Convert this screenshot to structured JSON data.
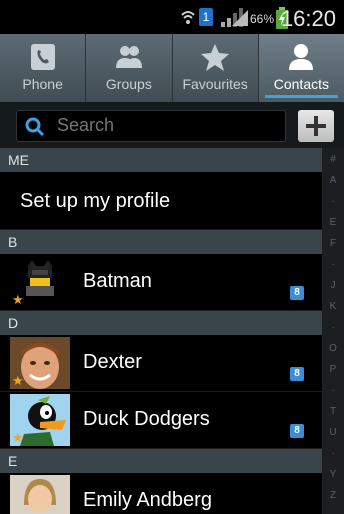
{
  "status_bar": {
    "battery_percent": "66%",
    "time": "16:20",
    "sim_label": "1"
  },
  "tabs": [
    {
      "label": "Phone",
      "icon": "phone-icon",
      "active": false
    },
    {
      "label": "Groups",
      "icon": "groups-icon",
      "active": false
    },
    {
      "label": "Favourites",
      "icon": "star-icon",
      "active": false
    },
    {
      "label": "Contacts",
      "icon": "person-icon",
      "active": true
    }
  ],
  "search": {
    "placeholder": "Search",
    "add_label": "+"
  },
  "sections": {
    "me": "ME",
    "profile_row": "Set up my profile",
    "b": "B",
    "d": "D",
    "e": "E"
  },
  "contacts": [
    {
      "name": "Batman",
      "badge": "8",
      "favourite": true,
      "avatar": "batman-avatar"
    },
    {
      "name": "Dexter",
      "badge": "8",
      "favourite": true,
      "avatar": "dexter-avatar"
    },
    {
      "name": "Duck Dodgers",
      "badge": "8",
      "favourite": true,
      "avatar": "duck-dodgers-avatar"
    },
    {
      "name": "Emily Andberg",
      "badge": "",
      "favourite": false,
      "avatar": "emily-avatar"
    }
  ],
  "index_letters": [
    "#",
    "A",
    "·",
    "E",
    "F",
    "·",
    "J",
    "K",
    "·",
    "O",
    "P",
    "·",
    "T",
    "U",
    "·",
    "Y",
    "Z"
  ],
  "colors": {
    "accent": "#3aa3e0",
    "section_bg": "#3a444b",
    "tab_bg": "#4d5a62",
    "star": "#f3a41c"
  }
}
